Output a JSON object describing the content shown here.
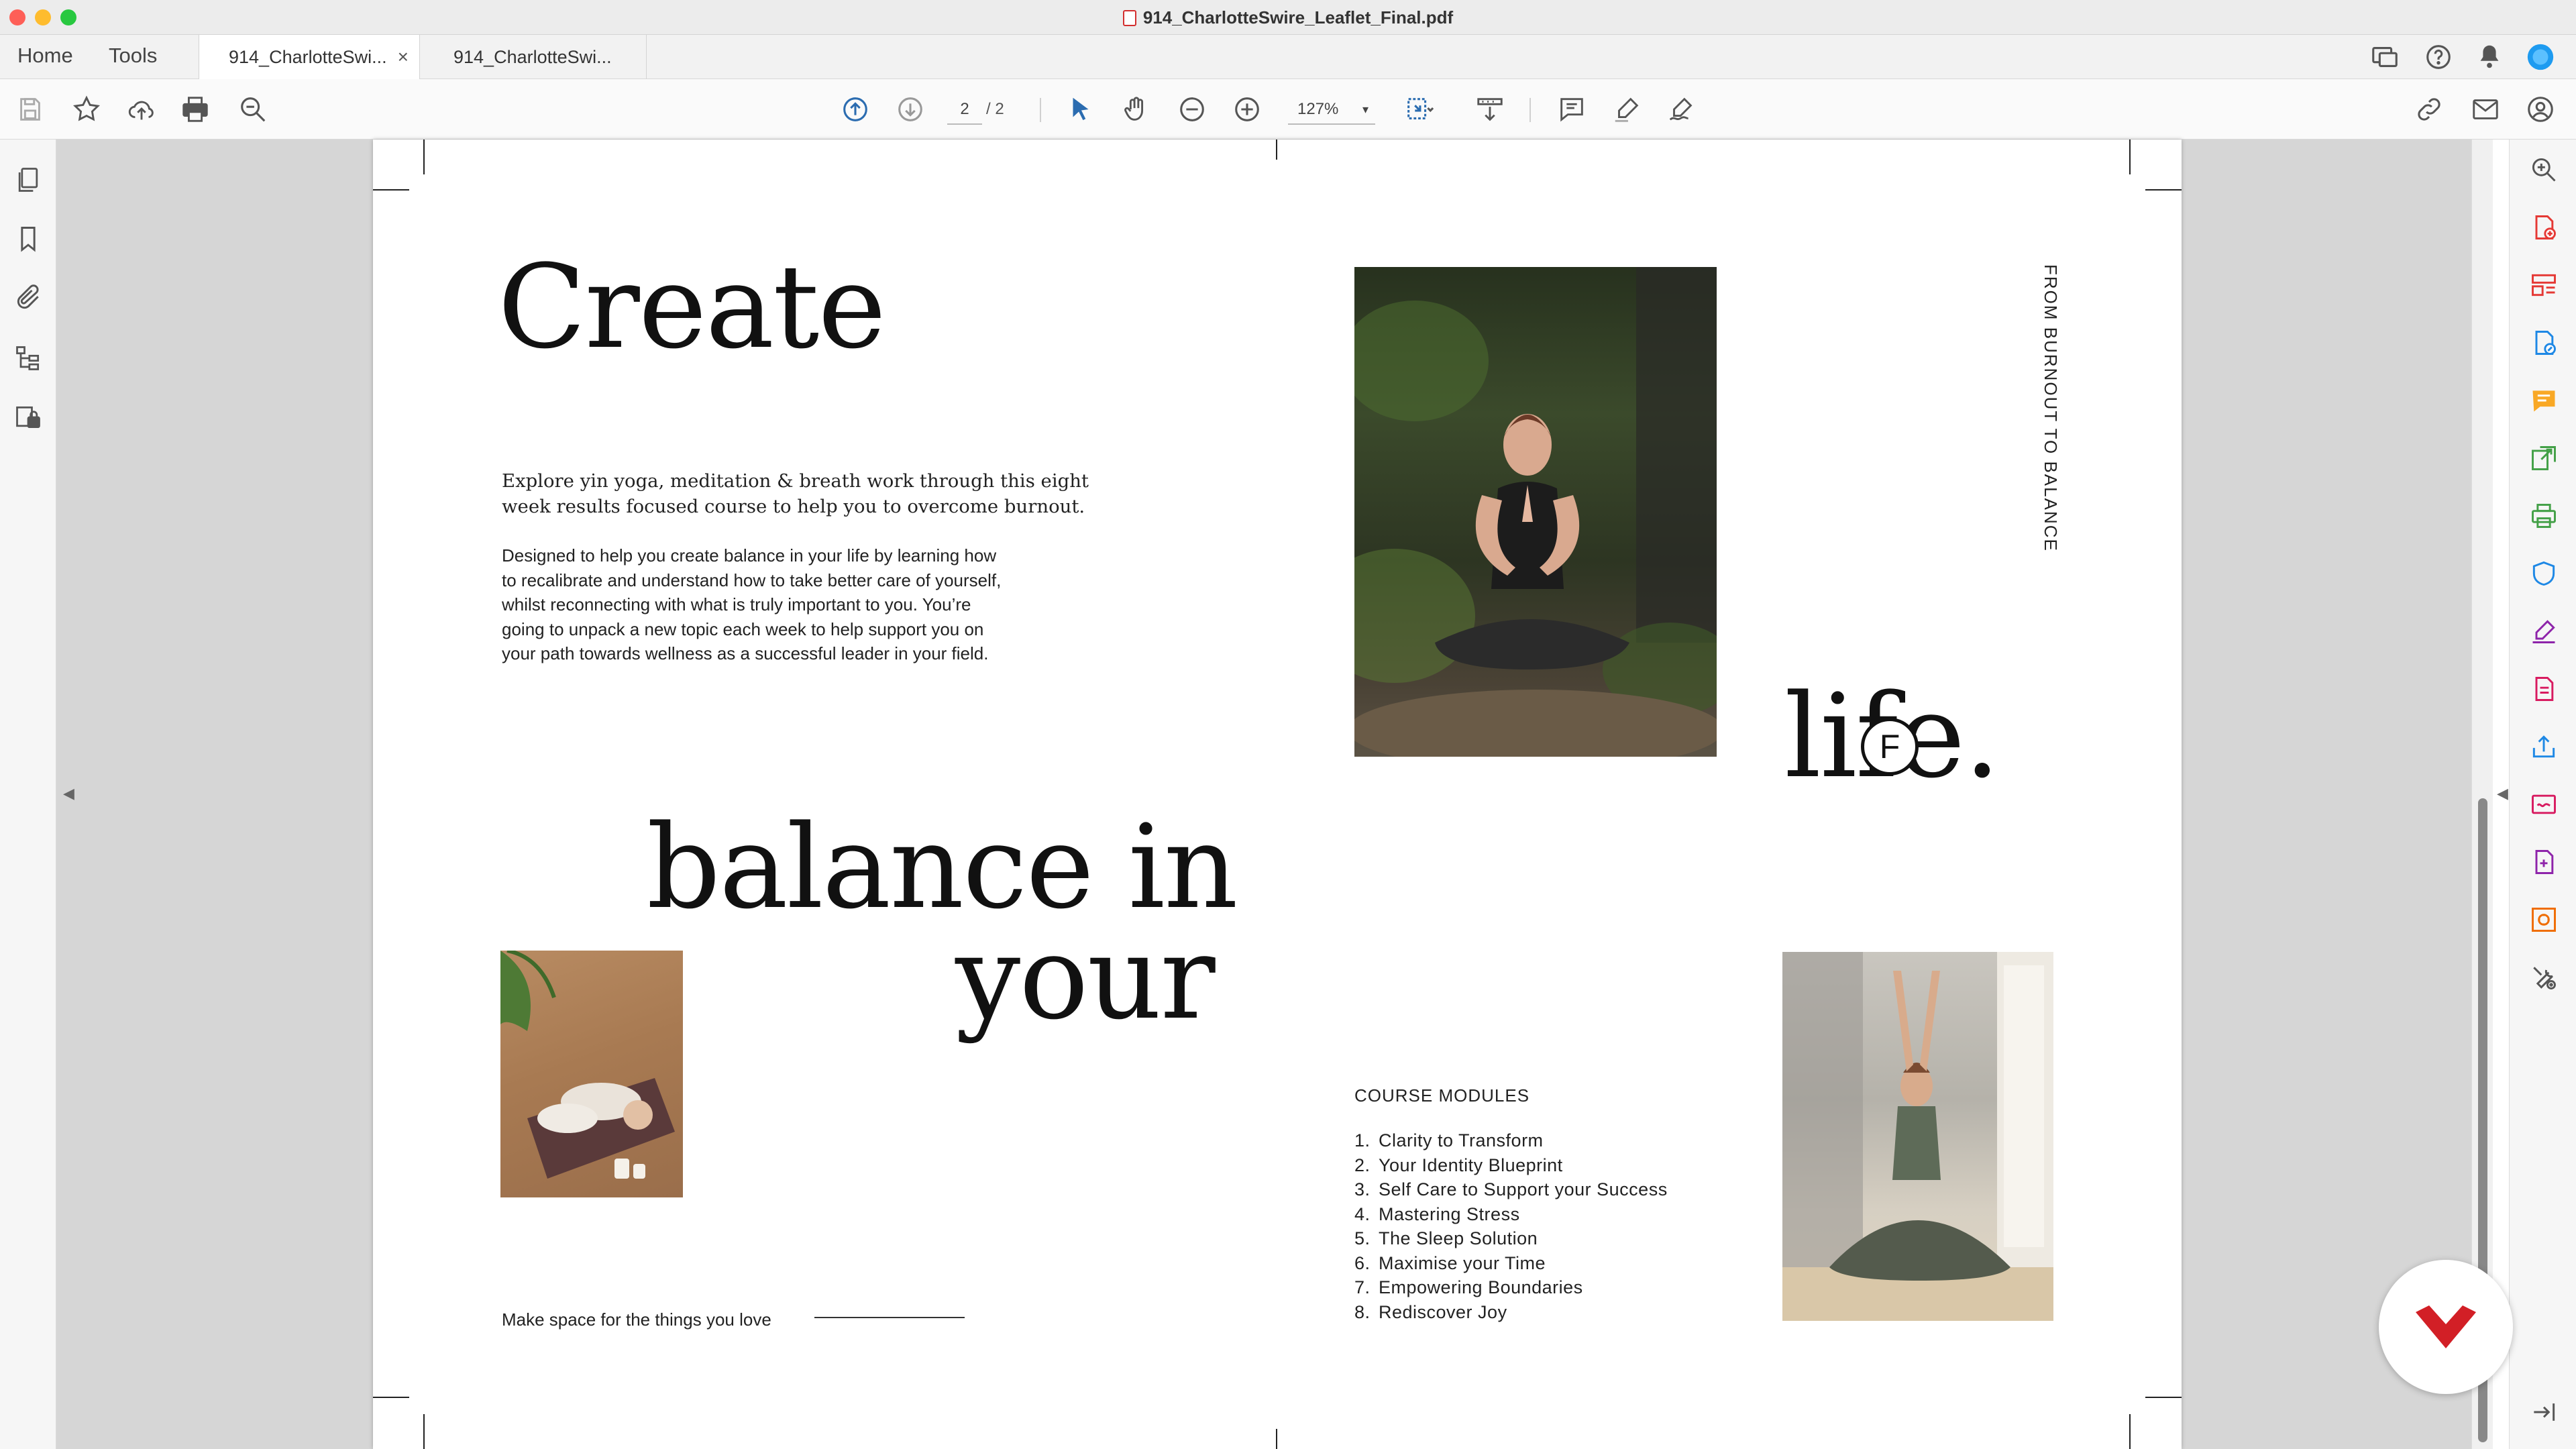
{
  "window": {
    "title": "914_CharlotteSwire_Leaflet_Final.pdf",
    "traffic_colors": [
      "#fe5f57",
      "#febc2e",
      "#28c840"
    ]
  },
  "tabs": {
    "home": "Home",
    "tools": "Tools",
    "doc1": "914_CharlotteSwi...",
    "doc1_close": "×",
    "doc2": "914_CharlotteSwi..."
  },
  "toolbar": {
    "page_current": "2",
    "page_total": "/ 2",
    "zoom": "127%"
  },
  "document": {
    "heading_create": "Create",
    "heading_balance": "balance in",
    "heading_your": "your",
    "heading_life": "life.",
    "logo_letter": "F",
    "intro": "Explore yin yoga, meditation & breath work through this eight week results focused course to help you to overcome burnout.",
    "intro_line1": "Explore yin yoga, meditation & breath work through this eight",
    "intro_line2": "week results focused course to help you to overcome burnout.",
    "body_lines": [
      "Designed to help you create balance in your life by learning how",
      "to recalibrate and understand how to take better care of yourself,",
      "whilst reconnecting with what is truly important to you. You’re",
      "going to unpack a new topic each week to help support you on",
      "your path towards wellness as a successful leader in your field."
    ],
    "vertical_text": "FROM BURNOUT TO BALANCE",
    "modules_title": "COURSE MODULES",
    "modules": [
      {
        "n": "1.",
        "label": "Clarity to Transform"
      },
      {
        "n": "2.",
        "label": "Your Identity Blueprint"
      },
      {
        "n": "3.",
        "label": "Self Care to Support your Success"
      },
      {
        "n": "4.",
        "label": "Mastering Stress"
      },
      {
        "n": "5.",
        "label": "The Sleep Solution"
      },
      {
        "n": "6.",
        "label": "Maximise your Time"
      },
      {
        "n": "7.",
        "label": "Empowering Boundaries"
      },
      {
        "n": "8.",
        "label": "Rediscover Joy"
      }
    ],
    "footer_text": "Make space for the things you love"
  },
  "colors": {
    "accent_blue": "#1e88e5",
    "pdf_red": "#d32f2f",
    "badge_red": "#d21f26"
  }
}
